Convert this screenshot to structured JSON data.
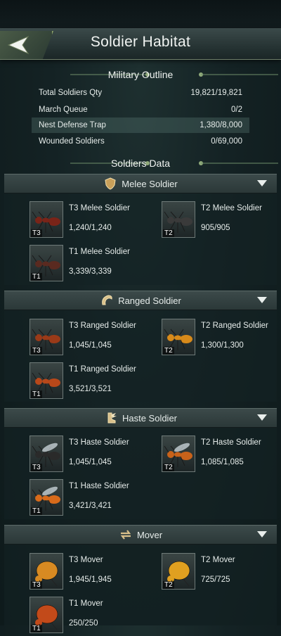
{
  "header": {
    "title": "Soldier Habitat"
  },
  "outline": {
    "heading": "Military Outline",
    "rows": [
      {
        "label": "Total Soldiers Qty",
        "value": "19,821/19,821"
      },
      {
        "label": "March Queue",
        "value": "0/2"
      },
      {
        "label": "Nest Defense Trap",
        "value": "1,380/8,000"
      },
      {
        "label": "Wounded Soldiers",
        "value": "0/69,000"
      }
    ]
  },
  "soldiers_data": {
    "heading": "Soldiers Data"
  },
  "categories": [
    {
      "title": "Melee Soldier",
      "icon": "shield-icon",
      "units": [
        {
          "name": "T3 Melee Soldier",
          "count": "1,240/1,240",
          "tier": "T3",
          "color": "#7a2418"
        },
        {
          "name": "T2 Melee Soldier",
          "count": "905/905",
          "tier": "T2",
          "color": "#3a3a3a"
        },
        {
          "name": "T1 Melee Soldier",
          "count": "3,339/3,339",
          "tier": "T1",
          "color": "#5a2a20"
        }
      ]
    },
    {
      "title": "Ranged Soldier",
      "icon": "ranged-arc-icon",
      "units": [
        {
          "name": "T3 Ranged Soldier",
          "count": "1,045/1,045",
          "tier": "T3",
          "color": "#9a3a18"
        },
        {
          "name": "T2 Ranged Soldier",
          "count": "1,300/1,300",
          "tier": "T2",
          "color": "#d88a1a"
        },
        {
          "name": "T1 Ranged Soldier",
          "count": "3,521/3,521",
          "tier": "T1",
          "color": "#b8481a"
        }
      ]
    },
    {
      "title": "Haste Soldier",
      "icon": "wing-boot-icon",
      "units": [
        {
          "name": "T3 Haste Soldier",
          "count": "1,045/1,045",
          "tier": "T3",
          "color": "#2a2a2a"
        },
        {
          "name": "T2 Haste Soldier",
          "count": "1,085/1,085",
          "tier": "T2",
          "color": "#c8621a"
        },
        {
          "name": "T1 Haste Soldier",
          "count": "3,421/3,421",
          "tier": "T1",
          "color": "#d86a1a"
        }
      ]
    },
    {
      "title": "Mover",
      "icon": "mover-arrows-icon",
      "units": [
        {
          "name": "T3 Mover",
          "count": "1,945/1,945",
          "tier": "T3",
          "color": "#d88a22"
        },
        {
          "name": "T2 Mover",
          "count": "725/725",
          "tier": "T2",
          "color": "#e0a020"
        },
        {
          "name": "T1 Mover",
          "count": "250/250",
          "tier": "T1",
          "color": "#c24a1a"
        }
      ]
    }
  ]
}
